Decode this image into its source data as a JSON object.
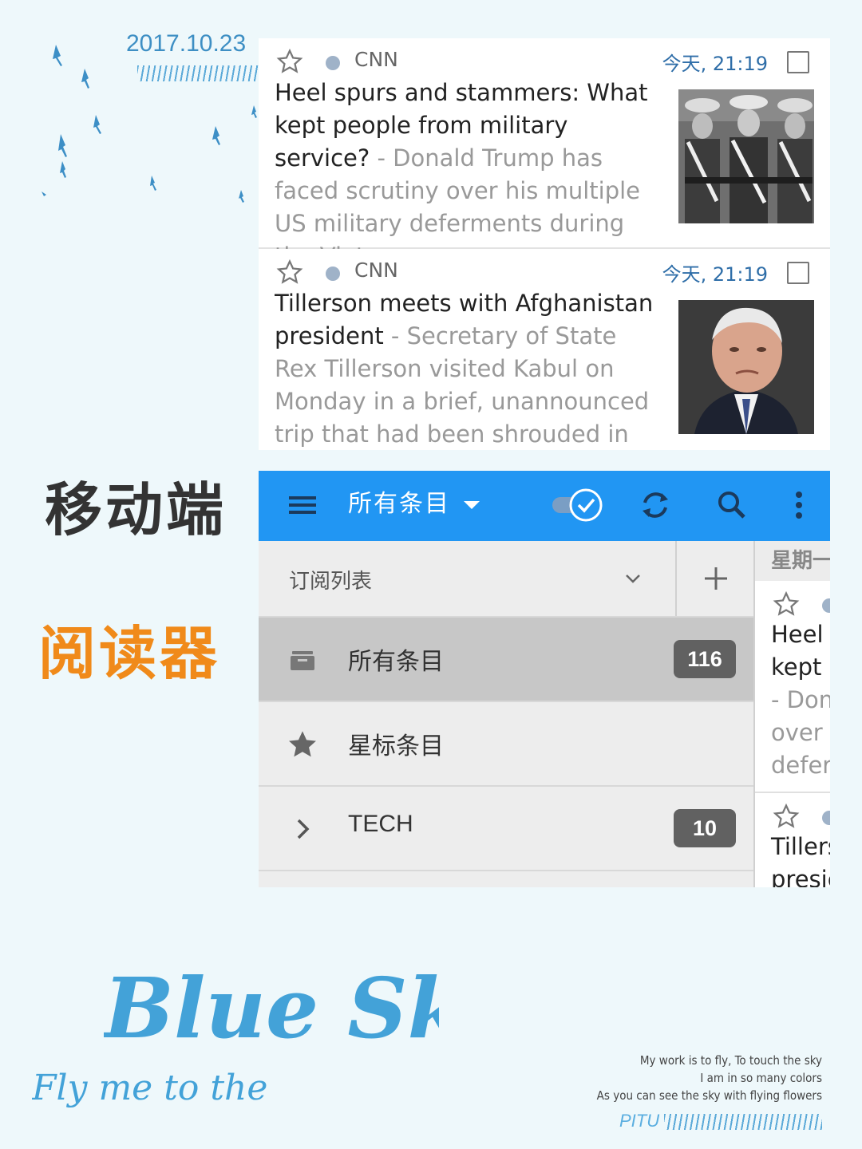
{
  "decor": {
    "date": "2017.10.23",
    "label_mobile": "移动端",
    "label_reader": "阅读器",
    "script_title": "Blue Sky",
    "script_subtitle": "Fly me to the",
    "poem": [
      "My work is to fly, To touch the sky",
      "I am in so many colors",
      "As you can see the sky with flying flowers"
    ],
    "brand": "PITU"
  },
  "articles": [
    {
      "source": "CNN",
      "time": "今天, 21:19",
      "title": "Heel spurs and stammers: What kept people from military service?",
      "summary": " - Donald Trump has faced scrutiny over his multiple US military deferments during the Vietnam",
      "image": "soldiers-photo"
    },
    {
      "source": "CNN",
      "time": "今天, 21:19",
      "title": "Tillerson meets with Afghanistan president",
      "summary": " - Secretary of State Rex Tillerson visited Kabul on Monday in a brief, unannounced trip that had been shrouded in secrecy",
      "image": "portrait-photo"
    }
  ],
  "app": {
    "toolbar_title": "所有条目",
    "toolbar_color": "#2196f3",
    "drawer_header": "订阅列表",
    "drawer_items": [
      {
        "label": "所有条目",
        "count": "116",
        "icon": "inbox-icon"
      },
      {
        "label": "星标条目",
        "count": "",
        "icon": "star-filled-icon"
      },
      {
        "label": "TECH",
        "count": "10",
        "icon": "chevron-right-icon"
      }
    ],
    "peek": {
      "day": "星期一",
      "item1": [
        "Heel s",
        "kept p",
        "- Don",
        "over h",
        "defer"
      ],
      "item2": [
        "Tillers",
        "presic"
      ]
    }
  }
}
